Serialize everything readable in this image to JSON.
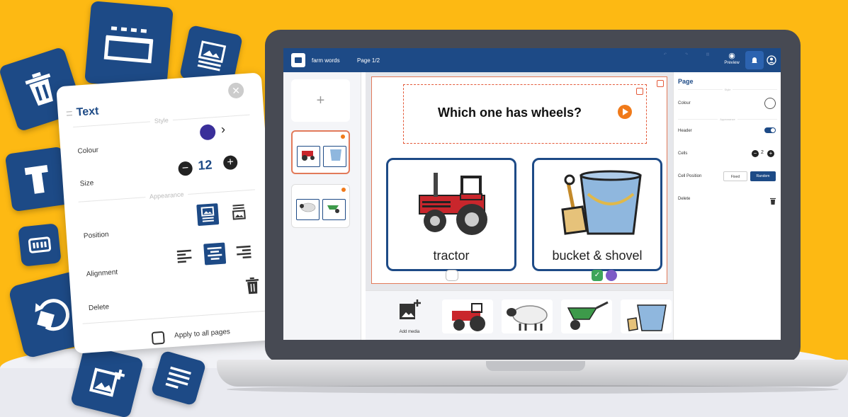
{
  "app": {
    "project_name": "farm words",
    "page_indicator": "Page 1/2",
    "toolbar": {
      "preview_label": "Preview"
    }
  },
  "text_panel": {
    "title": "Text",
    "style_section": "Style",
    "colour_label": "Colour",
    "size_label": "Size",
    "size_value": "12",
    "appearance_section": "Appearance",
    "position_label": "Position",
    "alignment_label": "Alignment",
    "delete_label": "Delete",
    "apply_all_label": "Apply to all pages",
    "colour_value": "#3a2f9a"
  },
  "page_editor": {
    "question": "Which one has wheels?",
    "cells": [
      {
        "label": "tractor"
      },
      {
        "label": "bucket & shovel"
      }
    ]
  },
  "media_bar": {
    "add_media_label": "Add media"
  },
  "properties": {
    "title": "Page",
    "style_section": "Style",
    "colour_label": "Colour",
    "appearance_section": "Appearance",
    "header_label": "Header",
    "cells_label": "Cells",
    "cells_value": "2",
    "cell_position_label": "Cell Position",
    "fixed_label": "Fixed",
    "random_label": "Random",
    "delete_label": "Delete"
  },
  "colors": {
    "brand": "#1d4a86",
    "background": "#fdb913",
    "accent": "#f07a1a"
  }
}
